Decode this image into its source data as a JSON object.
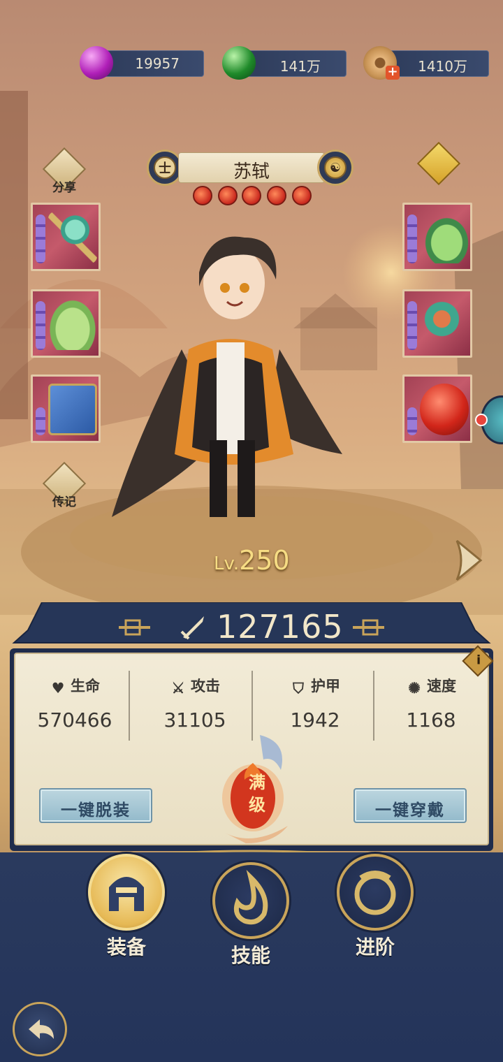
{
  "resources": [
    {
      "icon": "purple-gem-icon",
      "value": "19957",
      "color": "#b01fb8"
    },
    {
      "icon": "green-jade-icon",
      "value": "141万",
      "color": "#1f8a2a"
    },
    {
      "icon": "copper-coin-icon",
      "value": "1410万",
      "color": "#c89456"
    }
  ],
  "hero": {
    "name": "苏轼",
    "level_prefix": "Lv.",
    "level": "250",
    "stars": 5,
    "class_glyph": "士"
  },
  "side": {
    "share_label": "分享",
    "biography_label": "传记"
  },
  "equipment": {
    "left": [
      "wand-item",
      "robe-item",
      "book-item"
    ],
    "right": [
      "boots-item",
      "ornament-item",
      "jade-orb-item"
    ]
  },
  "power": {
    "value": "127165"
  },
  "stats": {
    "hp_label": "生命",
    "hp_value": "570466",
    "atk_label": "攻击",
    "atk_value": "31105",
    "armor_label": "护甲",
    "armor_value": "1942",
    "speed_label": "速度",
    "speed_value": "1168"
  },
  "actions": {
    "unequip_all": "一键脱装",
    "equip_all": "一键穿戴",
    "max_level_badge": "满级"
  },
  "tabs": [
    {
      "label": "装备",
      "active": true
    },
    {
      "label": "技能",
      "active": false
    },
    {
      "label": "进阶",
      "active": false
    }
  ],
  "info_glyph": "i"
}
